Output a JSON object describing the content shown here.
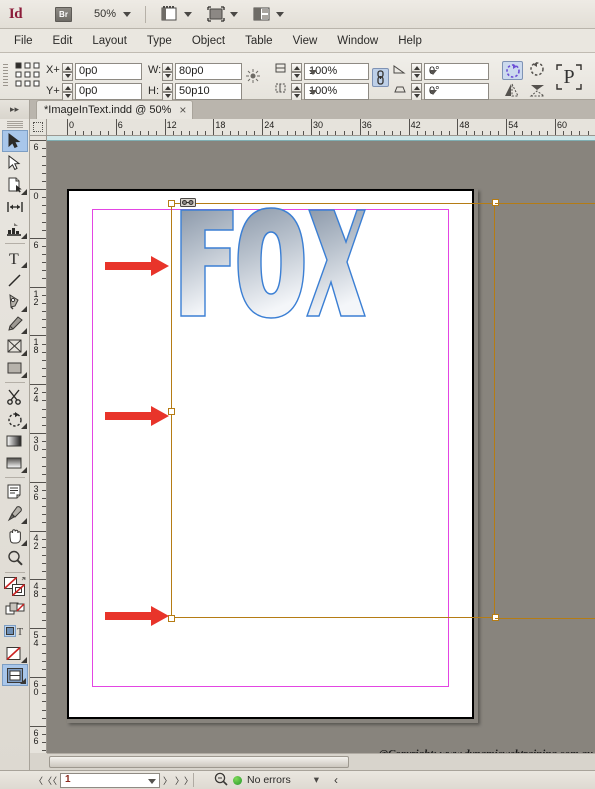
{
  "app": {
    "name": "Id",
    "bridge_label": "Br",
    "zoom_level": "50%",
    "toolbar_icons": [
      "screen-mode-icon",
      "frame-view-icon",
      "arrange-documents-icon",
      "workspace-switcher-icon"
    ]
  },
  "menu": {
    "items": [
      "File",
      "Edit",
      "Layout",
      "Type",
      "Object",
      "Table",
      "View",
      "Window",
      "Help"
    ]
  },
  "control_panel": {
    "reference_point_icon": "reference-point-proxy",
    "fields": [
      {
        "label": "X+",
        "value": "0p0",
        "name": "x-position-field"
      },
      {
        "label": "Y+",
        "value": "0p0",
        "name": "y-position-field"
      },
      {
        "label": "W:",
        "value": "80p0",
        "name": "width-field"
      },
      {
        "label": "H:",
        "value": "50p10",
        "name": "height-field"
      }
    ],
    "scale_x": "100%",
    "scale_y": "100%",
    "rotation_angle": "0°",
    "shear_angle": "0°",
    "constrain_proportions_icon": "chain-link-icon",
    "rotate_cw_icon": "rotate-clockwise-icon",
    "rotate_ccw_icon": "rotate-counterclockwise-icon",
    "flip_horizontal_icon": "flip-horizontal-icon",
    "flip_vertical_icon": "flip-vertical-icon",
    "auto_fit_label": "P",
    "select_container_icon": "select-container-icon",
    "select_content_icon": "select-content-icon"
  },
  "document_tab": {
    "title": "*ImageInText.indd @ 50%",
    "close_label": "×",
    "panel_toggle_icon": "expand-panels-icon"
  },
  "toolbox": {
    "tools": [
      {
        "name": "selection-tool",
        "icon": "arrow-solid-icon",
        "selected": true
      },
      {
        "name": "direct-selection-tool",
        "icon": "arrow-hollow-icon",
        "selected": false
      },
      {
        "name": "page-tool",
        "icon": "page-icon",
        "selected": false
      },
      {
        "name": "gap-tool",
        "icon": "gap-arrows-icon",
        "selected": false
      },
      {
        "name": "content-collector-tool",
        "icon": "content-collector-icon",
        "selected": false
      },
      {
        "name": "type-tool",
        "icon": "type-T-icon",
        "selected": false
      },
      {
        "name": "line-tool",
        "icon": "line-diagonal-icon",
        "selected": false
      },
      {
        "name": "pen-tool",
        "icon": "pen-nib-icon",
        "selected": false
      },
      {
        "name": "pencil-tool",
        "icon": "pencil-icon",
        "selected": false
      },
      {
        "name": "rectangle-frame-tool",
        "icon": "frame-x-icon",
        "selected": false
      },
      {
        "name": "rectangle-tool",
        "icon": "rectangle-icon",
        "selected": false
      },
      {
        "name": "scissors-tool",
        "icon": "scissors-icon",
        "selected": false
      },
      {
        "name": "free-transform-tool",
        "icon": "rotate-dashed-icon",
        "selected": false
      },
      {
        "name": "gradient-swatch-tool",
        "icon": "gradient-bar-icon",
        "selected": false
      },
      {
        "name": "gradient-feather-tool",
        "icon": "gradient-feather-icon",
        "selected": false
      },
      {
        "name": "note-tool",
        "icon": "note-page-icon",
        "selected": false
      },
      {
        "name": "eyedropper-tool",
        "icon": "eyedropper-icon",
        "selected": false
      },
      {
        "name": "hand-tool",
        "icon": "hand-icon",
        "selected": false
      },
      {
        "name": "zoom-tool",
        "icon": "magnifier-icon",
        "selected": false
      },
      {
        "name": "fill-stroke-swatches",
        "icon": "fill-stroke-none-icon",
        "selected": false
      },
      {
        "name": "formatting-target",
        "icon": "container-text-icon",
        "selected": false
      },
      {
        "name": "apply-none",
        "icon": "apply-none-icon",
        "selected": false
      },
      {
        "name": "screen-mode-tool",
        "icon": "screen-mode-icon",
        "selected": true
      }
    ]
  },
  "rulers": {
    "horizontal_ticks": [
      "0",
      "6",
      "12",
      "18",
      "24",
      "30",
      "36",
      "42",
      "48",
      "54",
      "60"
    ],
    "vertical_ticks": [
      "6",
      "0",
      "6",
      "12",
      "18",
      "24",
      "30",
      "36",
      "42",
      "48",
      "54",
      "60",
      "66"
    ],
    "units": "picas"
  },
  "canvas": {
    "artwork_text": "FOX",
    "frame_selected": true,
    "annotations": [
      {
        "name": "annotation-arrow-top",
        "icon": "red-arrow-right-icon"
      },
      {
        "name": "annotation-arrow-middle",
        "icon": "red-arrow-right-icon"
      },
      {
        "name": "annotation-arrow-bottom",
        "icon": "red-arrow-right-icon"
      }
    ],
    "colors": {
      "frame_stroke": "#b57c14",
      "margin_guide": "#e345e3",
      "text_stroke": "#3b7fd4",
      "annotation_arrow": "#e8342a",
      "gradient_start": "#8b98a8",
      "gradient_end": "#f2f4f7"
    }
  },
  "footer_text": "@Copyright: www.dynamicwebtraining.com.au",
  "status_bar": {
    "page_number": "1",
    "first_page_icon": "first-page-icon",
    "prev_page_icon": "prev-page-icon",
    "next_page_icon": "next-page-icon",
    "last_page_icon": "last-page-icon",
    "preflight_icon": "preflight-icon",
    "preflight_status": "No errors",
    "preflight_dot_color": "#2e9c2e",
    "menu_caret": "▾",
    "expand_label": "‹"
  }
}
